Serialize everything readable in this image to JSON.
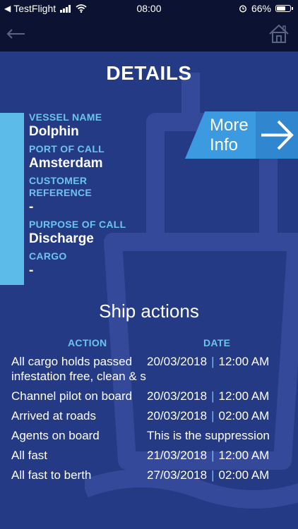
{
  "status_bar": {
    "carrier": "TestFlight",
    "time": "08:00",
    "battery_percent": "66%",
    "battery_level": 0.66
  },
  "nav": {
    "back_icon": "arrow-left-icon",
    "home_icon": "home-icon"
  },
  "page": {
    "title": "DETAILS"
  },
  "vessel": {
    "vessel_name_label": "VESSEL NAME",
    "vessel_name": "Dolphin",
    "port_label": "PORT OF CALL",
    "port": "Amsterdam",
    "customer_ref_label_1": "CUSTOMER",
    "customer_ref_label_2": "REFERENCE",
    "customer_ref": "-",
    "purpose_label": "PURPOSE OF CALL",
    "purpose": "Discharge",
    "cargo_label": "CARGO",
    "cargo": "-"
  },
  "more_info": {
    "label": "More\nInfo",
    "icon": "arrow-right-icon"
  },
  "ship_actions": {
    "title": "Ship actions",
    "col_action": "ACTION",
    "col_date": "DATE",
    "rows": [
      {
        "action": "All cargo holds passed infestation free, clean & s",
        "date": "20/03/2018",
        "time": "12:00 AM"
      },
      {
        "action": "Channel pilot on board",
        "date": "20/03/2018",
        "time": "12:00 AM"
      },
      {
        "action": "Arrived at roads",
        "date": "20/03/2018",
        "time": "02:00 AM"
      },
      {
        "action": "Agents on board",
        "note": "This is the suppression"
      },
      {
        "action": "All fast",
        "date": "21/03/2018",
        "time": "12:00 AM"
      },
      {
        "action": "All fast to berth",
        "date": "27/03/2018",
        "time": "02:00 AM"
      }
    ]
  },
  "colors": {
    "background": "#253a85",
    "bars": "#0c1332",
    "accent": "#5cbbe8",
    "label": "#6cc4ee",
    "more_info": "#3c9be0"
  }
}
